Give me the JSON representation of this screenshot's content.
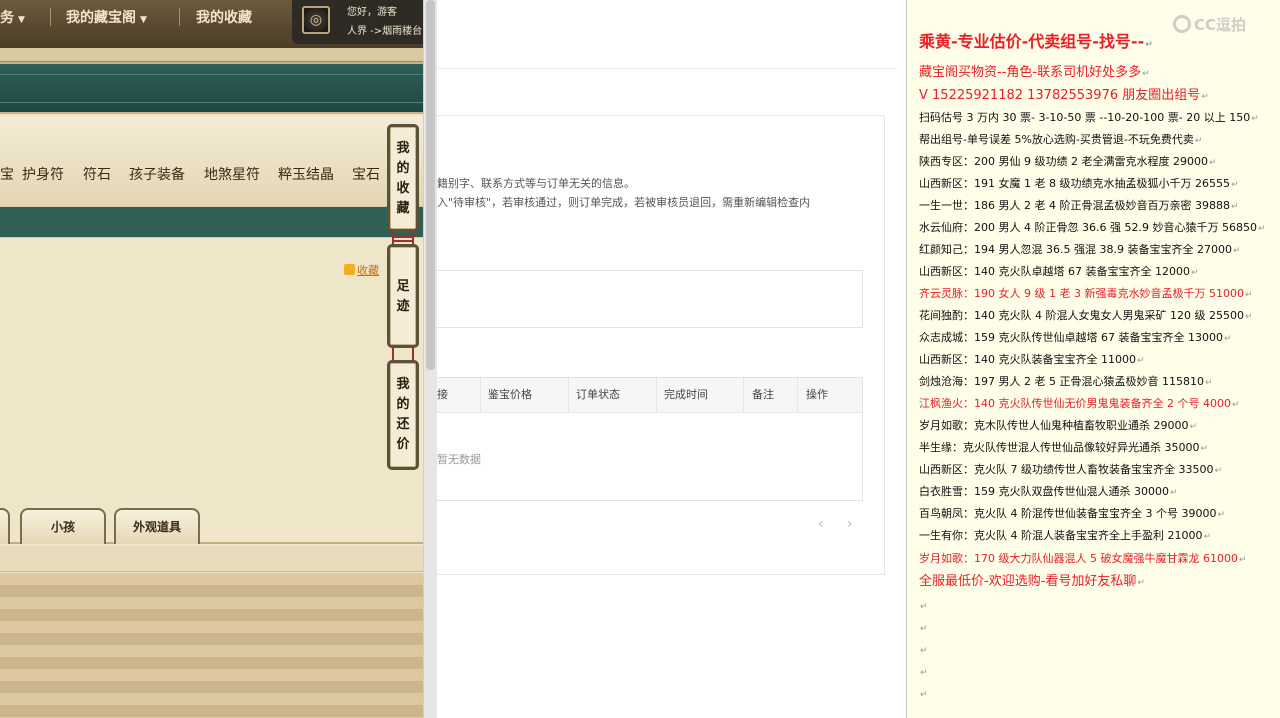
{
  "game": {
    "nav": [
      {
        "label": "务",
        "caret": "▼"
      },
      {
        "label": "我的藏宝阁",
        "caret": "▼"
      },
      {
        "label": "我的收藏",
        "caret": ""
      }
    ],
    "user": {
      "greeting": "您好，游客",
      "location": "人界 ->烟雨楼台"
    },
    "categories": [
      "宝",
      "护身符",
      "符石",
      "孩子装备",
      "地煞星符",
      "粹玉结晶",
      "宝石"
    ],
    "fav_link": "收藏",
    "tabs": [
      "小孩",
      "外观道具"
    ],
    "side_buttons": [
      {
        "chars": [
          "我",
          "的",
          "收",
          "藏"
        ]
      },
      {
        "chars": [
          "足",
          "迹"
        ]
      },
      {
        "chars": [
          "我",
          "的",
          "还",
          "价"
        ]
      }
    ]
  },
  "web": {
    "notes": [
      "籍别字、联系方式等与订单无关的信息。",
      "入\"待审核\"，若审核通过，则订单完成，若被审核员退回，需重新编辑检查内"
    ],
    "table_headers": [
      "接",
      "鉴宝价格",
      "订单状态",
      "完成时间",
      "备注",
      "操作"
    ],
    "no_data": "暂无数据",
    "pager": {
      "prev": "‹",
      "next": "›"
    }
  },
  "right": {
    "watermark": "CC逗拍",
    "return_mark": "↵",
    "lines": [
      {
        "text": "乘黄-专业估价-代卖组号-找号--",
        "style": "big"
      },
      {
        "text": "藏宝阁买物资--角色-联系司机好处多多",
        "style": "mid"
      },
      {
        "text": "V 15225921182   13782553976 朋友圈出组号",
        "style": "mid"
      },
      {
        "text": "扫码估号 3 万内 30 票- 3-10-50 票  --10-20-100 票- 20 以上 150",
        "style": ""
      },
      {
        "text": "帮出组号-单号误差 5%放心选购-买贵管退-不玩免费代卖",
        "style": ""
      },
      {
        "text": "陕西专区：200 男仙 9 级功绩 2 老全满雷克水程度 29000",
        "style": ""
      },
      {
        "text": "山西新区：191 女魔 1 老 8 级功绩克水抽孟极狐小千万 26555",
        "style": ""
      },
      {
        "text": "一生一世：186 男人 2 老 4 阶正骨混孟极妙音百万亲密 39888",
        "style": ""
      },
      {
        "text": "水云仙府：200 男人 4 阶正骨忽 36.6 强 52.9 妙音心猿千万 56850",
        "style": ""
      },
      {
        "text": "红颜知己：194 男人忽混 36.5 强混 38.9 装备宝宝齐全 27000",
        "style": ""
      },
      {
        "text": "山西新区：140 克火队卓越塔 67 装备宝宝齐全 12000",
        "style": ""
      },
      {
        "text": "齐云灵脉：190 女人 9 级 1 老 3 新强毒克水妙音孟极千万 51000",
        "style": "red"
      },
      {
        "text": "花间独酌：140 克火队 4 阶混人女鬼女人男鬼采矿 120 级 25500",
        "style": ""
      },
      {
        "text": "众志成城：159 克火队传世仙卓越塔 67 装备宝宝齐全 13000",
        "style": ""
      },
      {
        "text": "山西新区：140 克火队装备宝宝齐全 11000",
        "style": ""
      },
      {
        "text": "剑烛沧海：197 男人 2 老 5 正骨混心猿孟极妙音 115810",
        "style": ""
      },
      {
        "text": "江枫渔火：140 克火队传世仙无价男鬼鬼装备齐全 2 个号 4000",
        "style": "red"
      },
      {
        "text": "岁月如歌：克木队传世人仙鬼种植畜牧职业通杀 29000",
        "style": ""
      },
      {
        "text": "半生缘：克火队传世混人传世仙品像较好异光通杀 35000",
        "style": ""
      },
      {
        "text": "山西新区：克火队 7 级功绩传世人畜牧装备宝宝齐全 33500",
        "style": ""
      },
      {
        "text": "白衣胜雪：159 克火队双盘传世仙混人通杀 30000",
        "style": ""
      },
      {
        "text": "百鸟朝凤：克火队 4 阶混传世仙装备宝宝齐全 3 个号 39000",
        "style": ""
      },
      {
        "text": "一生有你：克火队 4 阶混人装备宝宝齐全上手盈利 21000",
        "style": ""
      },
      {
        "text": "岁月如歌：170 级大力队仙器混人 5 破女魔强牛魔甘霖龙 61000",
        "style": "red"
      },
      {
        "text": "全服最低价-欢迎选购-看号加好友私聊",
        "style": "mid"
      },
      {
        "text": "",
        "style": ""
      },
      {
        "text": "",
        "style": ""
      },
      {
        "text": "",
        "style": ""
      },
      {
        "text": "",
        "style": ""
      },
      {
        "text": "",
        "style": ""
      }
    ]
  }
}
